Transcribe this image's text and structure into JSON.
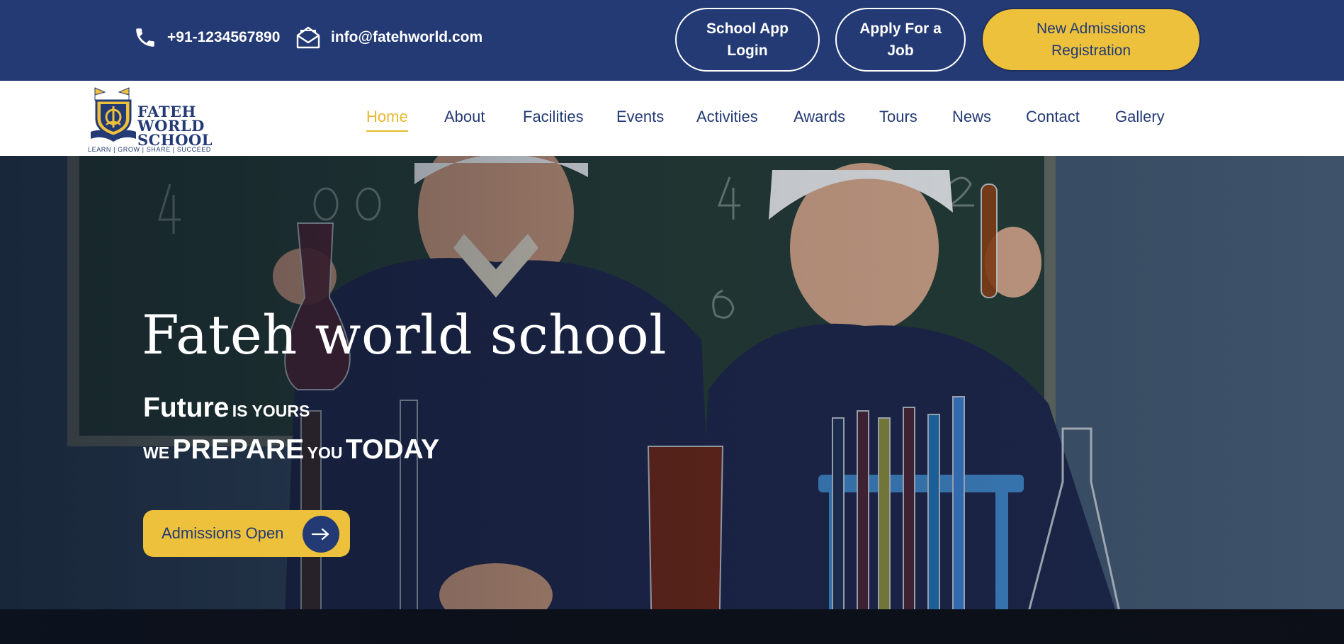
{
  "topbar": {
    "phone": "+91-1234567890",
    "email": "info@fatehworld.com",
    "buttons": {
      "app_login_line1": "School App",
      "app_login_line2": "Login",
      "job_line1": "Apply For a",
      "job_line2": "Job",
      "admission_line1": "New Admissions",
      "admission_line2": "Registration"
    },
    "icons": {
      "phone": "phone-icon",
      "email": "envelope-icon"
    }
  },
  "logo": {
    "line1": "FATEH",
    "line2": "WORLD",
    "line3": "SCHOOL",
    "tagline": "LEARN | GROW | SHARE | SUCCEED"
  },
  "nav": {
    "items": [
      "Home",
      "About",
      "Facilities",
      "Events",
      "Activities",
      "Awards",
      "Tours",
      "News",
      "Contact",
      "Gallery"
    ],
    "active": "Home"
  },
  "hero": {
    "title": "Fateh world school",
    "line1_big": "Future",
    "line1_small": "IS YOURS",
    "line2_a": "WE",
    "line2_b": "PREPARE",
    "line2_c": "YOU",
    "line2_d": "TODAY",
    "cta_label": "Admissions Open",
    "cta_icon": "arrow-right-icon"
  },
  "colors": {
    "navy": "#233a74",
    "gold": "#edc13c",
    "white": "#ffffff"
  }
}
